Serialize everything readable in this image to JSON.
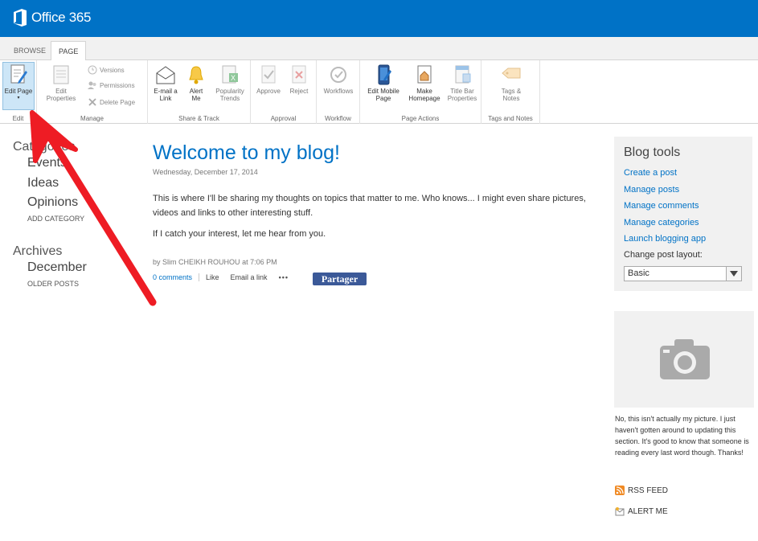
{
  "app": {
    "title": "Office 365"
  },
  "tabs": [
    {
      "label": "BROWSE"
    },
    {
      "label": "PAGE"
    }
  ],
  "ribbon": {
    "groups": {
      "edit": "Edit",
      "manage": "Manage",
      "share": "Share & Track",
      "approval": "Approval",
      "workflow": "Workflow",
      "page_actions": "Page Actions",
      "tags": "Tags and Notes"
    },
    "buttons": {
      "edit_page": "Edit Page",
      "edit_properties_1": "Edit",
      "edit_properties_2": "Properties",
      "versions": "Versions",
      "permissions": "Permissions",
      "delete_page": "Delete Page",
      "email_1": "E-mail a",
      "email_2": "Link",
      "alert_1": "Alert",
      "alert_2": "Me",
      "popularity_1": "Popularity",
      "popularity_2": "Trends",
      "approve": "Approve",
      "reject": "Reject",
      "workflows": "Workflows",
      "mobile_1": "Edit Mobile",
      "mobile_2": "Page",
      "homepage_1": "Make",
      "homepage_2": "Homepage",
      "titlebar_1": "Title Bar",
      "titlebar_2": "Properties",
      "tags_1": "Tags &",
      "tags_2": "Notes"
    }
  },
  "leftnav": {
    "categories_heading": "Categories",
    "categories": [
      "Events",
      "Ideas",
      "Opinions"
    ],
    "add_category": "ADD CATEGORY",
    "archives_heading": "Archives",
    "archives": [
      "December"
    ],
    "older_posts": "OLDER POSTS"
  },
  "post": {
    "title": "Welcome to my blog!",
    "date": "Wednesday, December 17, 2014",
    "body_1": "This is where I'll be sharing my thoughts on topics that matter to me. Who knows... I might even share pictures, videos and links to other interesting stuff.",
    "body_2": "If I catch your interest, let me hear from you.",
    "byline_prefix": "by",
    "author": "Slim CHEIKH ROUHOU",
    "byline_at": "at",
    "time": "7:06 PM",
    "comments": "0 comments",
    "like": "Like",
    "email_link": "Email a link",
    "more": "•••",
    "share_button": "Partager"
  },
  "blog_tools": {
    "title": "Blog tools",
    "links": [
      "Create a post",
      "Manage posts",
      "Manage comments",
      "Manage categories",
      "Launch blogging app"
    ],
    "layout_label": "Change post layout:",
    "layout_value": "Basic"
  },
  "photo_caption": "No, this isn't actually my picture. I just haven't gotten around to updating this section. It's good to know that someone is reading every last word though. Thanks!",
  "feeds": {
    "rss": "RSS FEED",
    "alert": "ALERT ME"
  },
  "colors": {
    "brand": "#0072c6",
    "arrow": "#ee1c24",
    "share": "#3b5998"
  }
}
